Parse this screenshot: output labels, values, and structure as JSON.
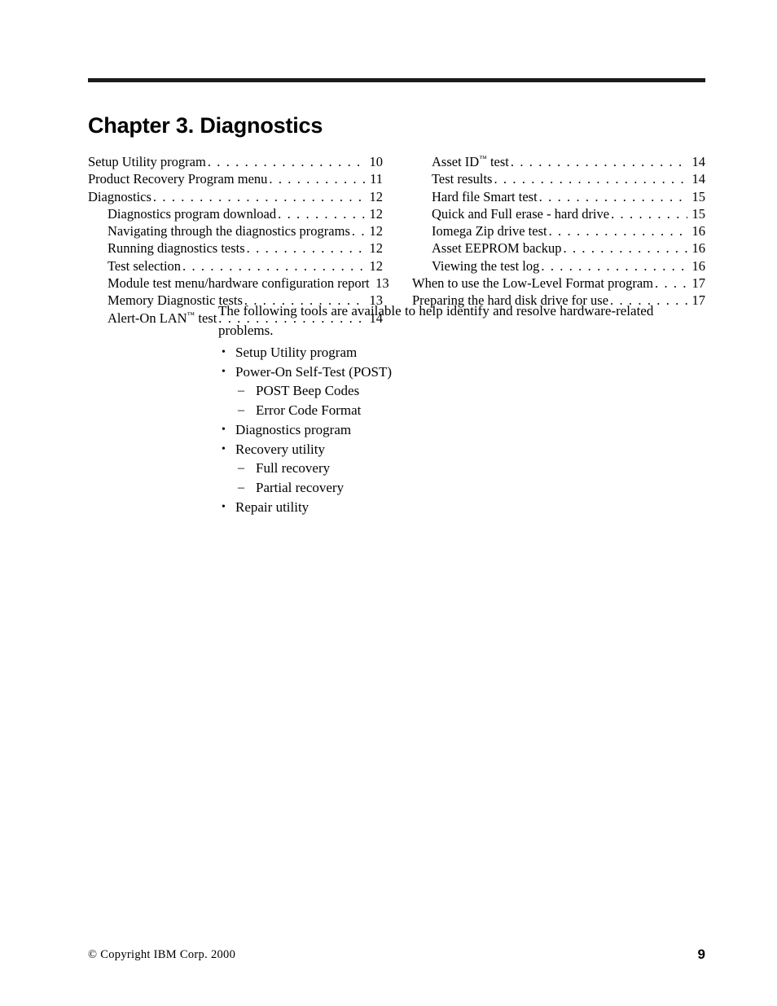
{
  "document": {
    "chapter_title": "Chapter 3. Diagnostics"
  },
  "toc": {
    "left_column": [
      {
        "label": "Setup Utility program",
        "page": "10",
        "indent": false,
        "dots": true,
        "tm": false
      },
      {
        "label": "Product Recovery Program menu",
        "page": "11",
        "indent": false,
        "dots": true,
        "tm": false
      },
      {
        "label": "Diagnostics",
        "page": "12",
        "indent": false,
        "dots": true,
        "tm": false
      },
      {
        "label": "Diagnostics program download",
        "page": "12",
        "indent": true,
        "dots": true,
        "tm": false
      },
      {
        "label": "Navigating through the diagnostics programs",
        "page": "12",
        "indent": true,
        "dots": true,
        "tm": false
      },
      {
        "label": "Running diagnostics tests",
        "page": "12",
        "indent": true,
        "dots": true,
        "tm": false
      },
      {
        "label": "Test selection",
        "page": "12",
        "indent": true,
        "dots": true,
        "tm": false
      },
      {
        "label": "Module test menu/hardware configuration report",
        "page": "13",
        "indent": true,
        "dots": false,
        "tm": false
      },
      {
        "label": "Memory Diagnostic tests",
        "page": "13",
        "indent": true,
        "dots": true,
        "tm": false
      },
      {
        "label": "Alert-On LAN",
        "label_suffix": " test",
        "page": "14",
        "indent": true,
        "dots": true,
        "tm": true
      }
    ],
    "right_column": [
      {
        "label": "Asset ID",
        "label_suffix": " test",
        "page": "14",
        "indent": true,
        "dots": true,
        "tm": true
      },
      {
        "label": "Test results",
        "page": "14",
        "indent": true,
        "dots": true,
        "tm": false
      },
      {
        "label": "Hard file Smart test",
        "page": "15",
        "indent": true,
        "dots": true,
        "tm": false
      },
      {
        "label": "Quick and Full erase - hard drive",
        "page": "15",
        "indent": true,
        "dots": true,
        "tm": false
      },
      {
        "label": "Iomega Zip drive test",
        "page": "16",
        "indent": true,
        "dots": true,
        "tm": false
      },
      {
        "label": "Asset EEPROM backup",
        "page": "16",
        "indent": true,
        "dots": true,
        "tm": false
      },
      {
        "label": "Viewing the test log",
        "page": "16",
        "indent": true,
        "dots": true,
        "tm": false
      },
      {
        "label": "When to use the Low-Level Format program",
        "page": "17",
        "indent": false,
        "dots": true,
        "tm": false
      },
      {
        "label": "Preparing the hard disk drive for use",
        "page": "17",
        "indent": false,
        "dots": true,
        "tm": false
      }
    ]
  },
  "body": {
    "intro": "The following tools are available to help identify and resolve hardware-related problems.",
    "bullet_marker": "•",
    "dash_marker": "–",
    "items": [
      {
        "text": "Setup Utility program",
        "children": []
      },
      {
        "text": "Power-On Self-Test (POST)",
        "children": [
          "POST Beep Codes",
          "Error Code Format"
        ]
      },
      {
        "text": "Diagnostics program",
        "children": []
      },
      {
        "text": "Recovery utility",
        "children": [
          "Full recovery",
          "Partial recovery"
        ]
      },
      {
        "text": "Repair utility",
        "children": []
      }
    ]
  },
  "footer": {
    "copyright": "© Copyright IBM Corp. 2000",
    "page_number": "9"
  }
}
